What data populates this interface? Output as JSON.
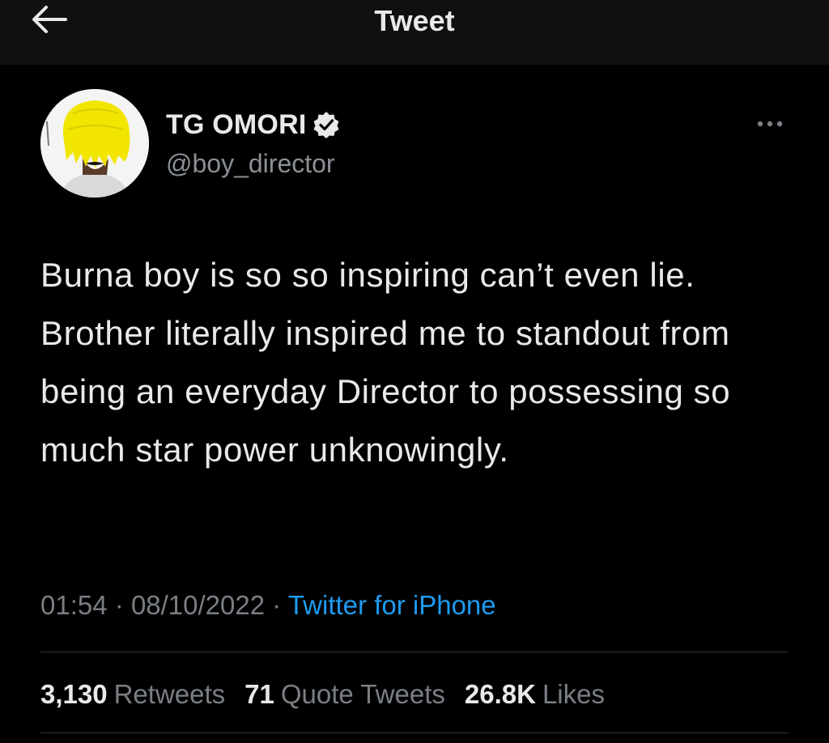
{
  "header": {
    "title": "Tweet",
    "back_icon": "arrow-left-icon"
  },
  "author": {
    "display_name": "TG OMORI",
    "handle": "@boy_director",
    "verified_icon": "verified-badge-icon",
    "more_icon": "more-horizontal-icon"
  },
  "tweet": {
    "text": "Burna boy is so so inspiring can’t even lie. Brother literally inspired me to standout from being an everyday Director to possessing so much star power unknowingly."
  },
  "meta": {
    "time": "01:54",
    "separator": "·",
    "date": "08/10/2022",
    "source": "Twitter for iPhone"
  },
  "stats": {
    "retweets_count": "3,130",
    "retweets_label": "Retweets",
    "quotes_count": "71",
    "quotes_label": "Quote Tweets",
    "likes_count": "26.8K",
    "likes_label": "Likes"
  },
  "colors": {
    "background": "#000000",
    "header_background": "#101010",
    "text_primary": "#e7e9ea",
    "text_secondary": "#7a7f85",
    "link": "#1d9bf0",
    "divider": "#2f3336",
    "avatar_hair": "#f2e600"
  }
}
